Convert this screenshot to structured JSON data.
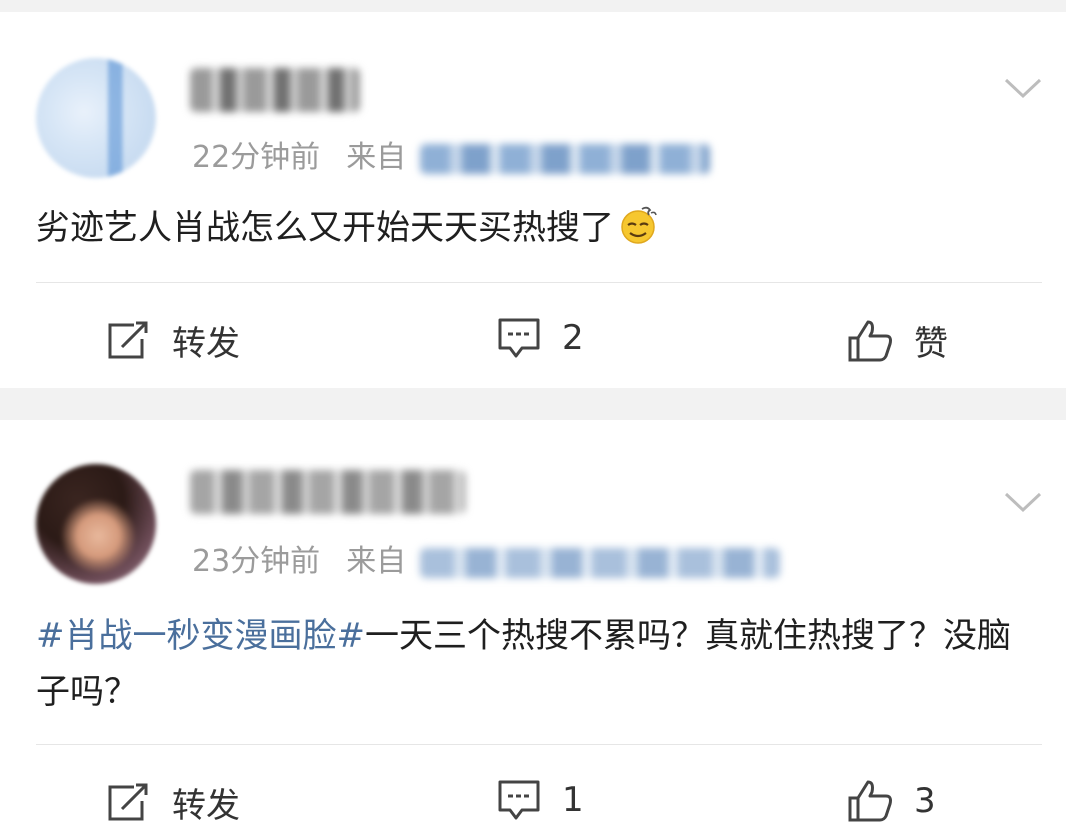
{
  "posts": [
    {
      "time": "22分钟前",
      "from_label": "来自",
      "content_text": "劣迹艺人肖战怎么又开始天天买热搜了",
      "actions": {
        "repost": "转发",
        "comment": "2",
        "like": "赞"
      }
    },
    {
      "time": "23分钟前",
      "from_label": "来自",
      "hashtag": "#肖战一秒变漫画脸#",
      "content_text": "一天三个热搜不累吗？真就住热搜了？没脑子吗？",
      "actions": {
        "repost": "转发",
        "comment": "1",
        "like": "3"
      }
    }
  ],
  "icons": {
    "dropdown": "chevron-down-icon",
    "repost": "repost-icon",
    "comment": "comment-icon",
    "like": "thumbs-up-icon",
    "emoji": "thinking-emoji-icon"
  },
  "colors": {
    "hashtag": "#4a6f9c",
    "meta": "#9b9b9b",
    "background": "#f2f2f2"
  }
}
